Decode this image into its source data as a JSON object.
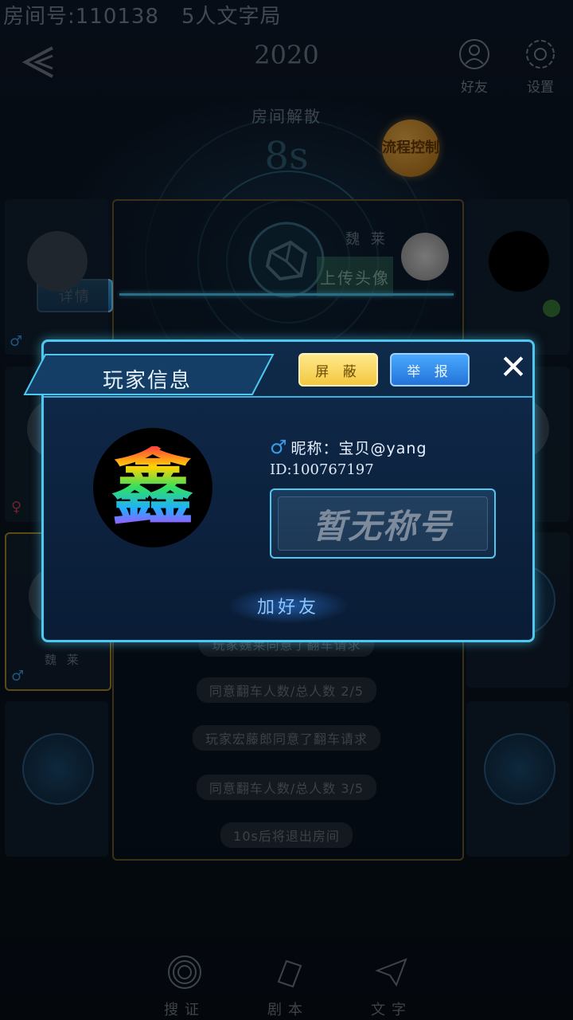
{
  "top_bar": {
    "room_number": "房间号:110138",
    "room_type": "5人文字局",
    "year": "2020",
    "friends_label": "好友",
    "settings_label": "设置"
  },
  "disband": {
    "label": "房间解散",
    "countdown": "8s",
    "flow_control_label": "流程控制"
  },
  "board": {
    "detail_label": "详情",
    "player_name": "魏 莱",
    "upload_avatar_label": "上传头像",
    "log": [
      "玩家魏莱同意了翻车请求",
      "同意翻车人数/总人数 2/5",
      "玩家宏藤郎同意了翻车请求",
      "同意翻车人数/总人数 3/5",
      "10s后将退出房间"
    ]
  },
  "seats": {
    "left_gold_name": "魏 莱"
  },
  "modal": {
    "title": "玩家信息",
    "block_label": "屏 蔽",
    "report_label": "举 报",
    "close_symbol": "✕",
    "avatar_glyph": "鑫",
    "nickname_line": "昵称：宝贝@yang",
    "id_line": "ID:100767197",
    "title_badge": "暂无称号",
    "add_friend_label": "加好友"
  },
  "bottom_nav": [
    {
      "label": "搜证",
      "icon": "fingerprint-icon"
    },
    {
      "label": "剧本",
      "icon": "book-icon"
    },
    {
      "label": "文字",
      "icon": "paper-plane-icon"
    }
  ],
  "colors": {
    "accent": "#4ec8ef",
    "modal_bg": "#0f2a4a",
    "block_btn": "#f3c840",
    "report_btn": "#2473d8",
    "flow_btn": "#e0962e"
  }
}
